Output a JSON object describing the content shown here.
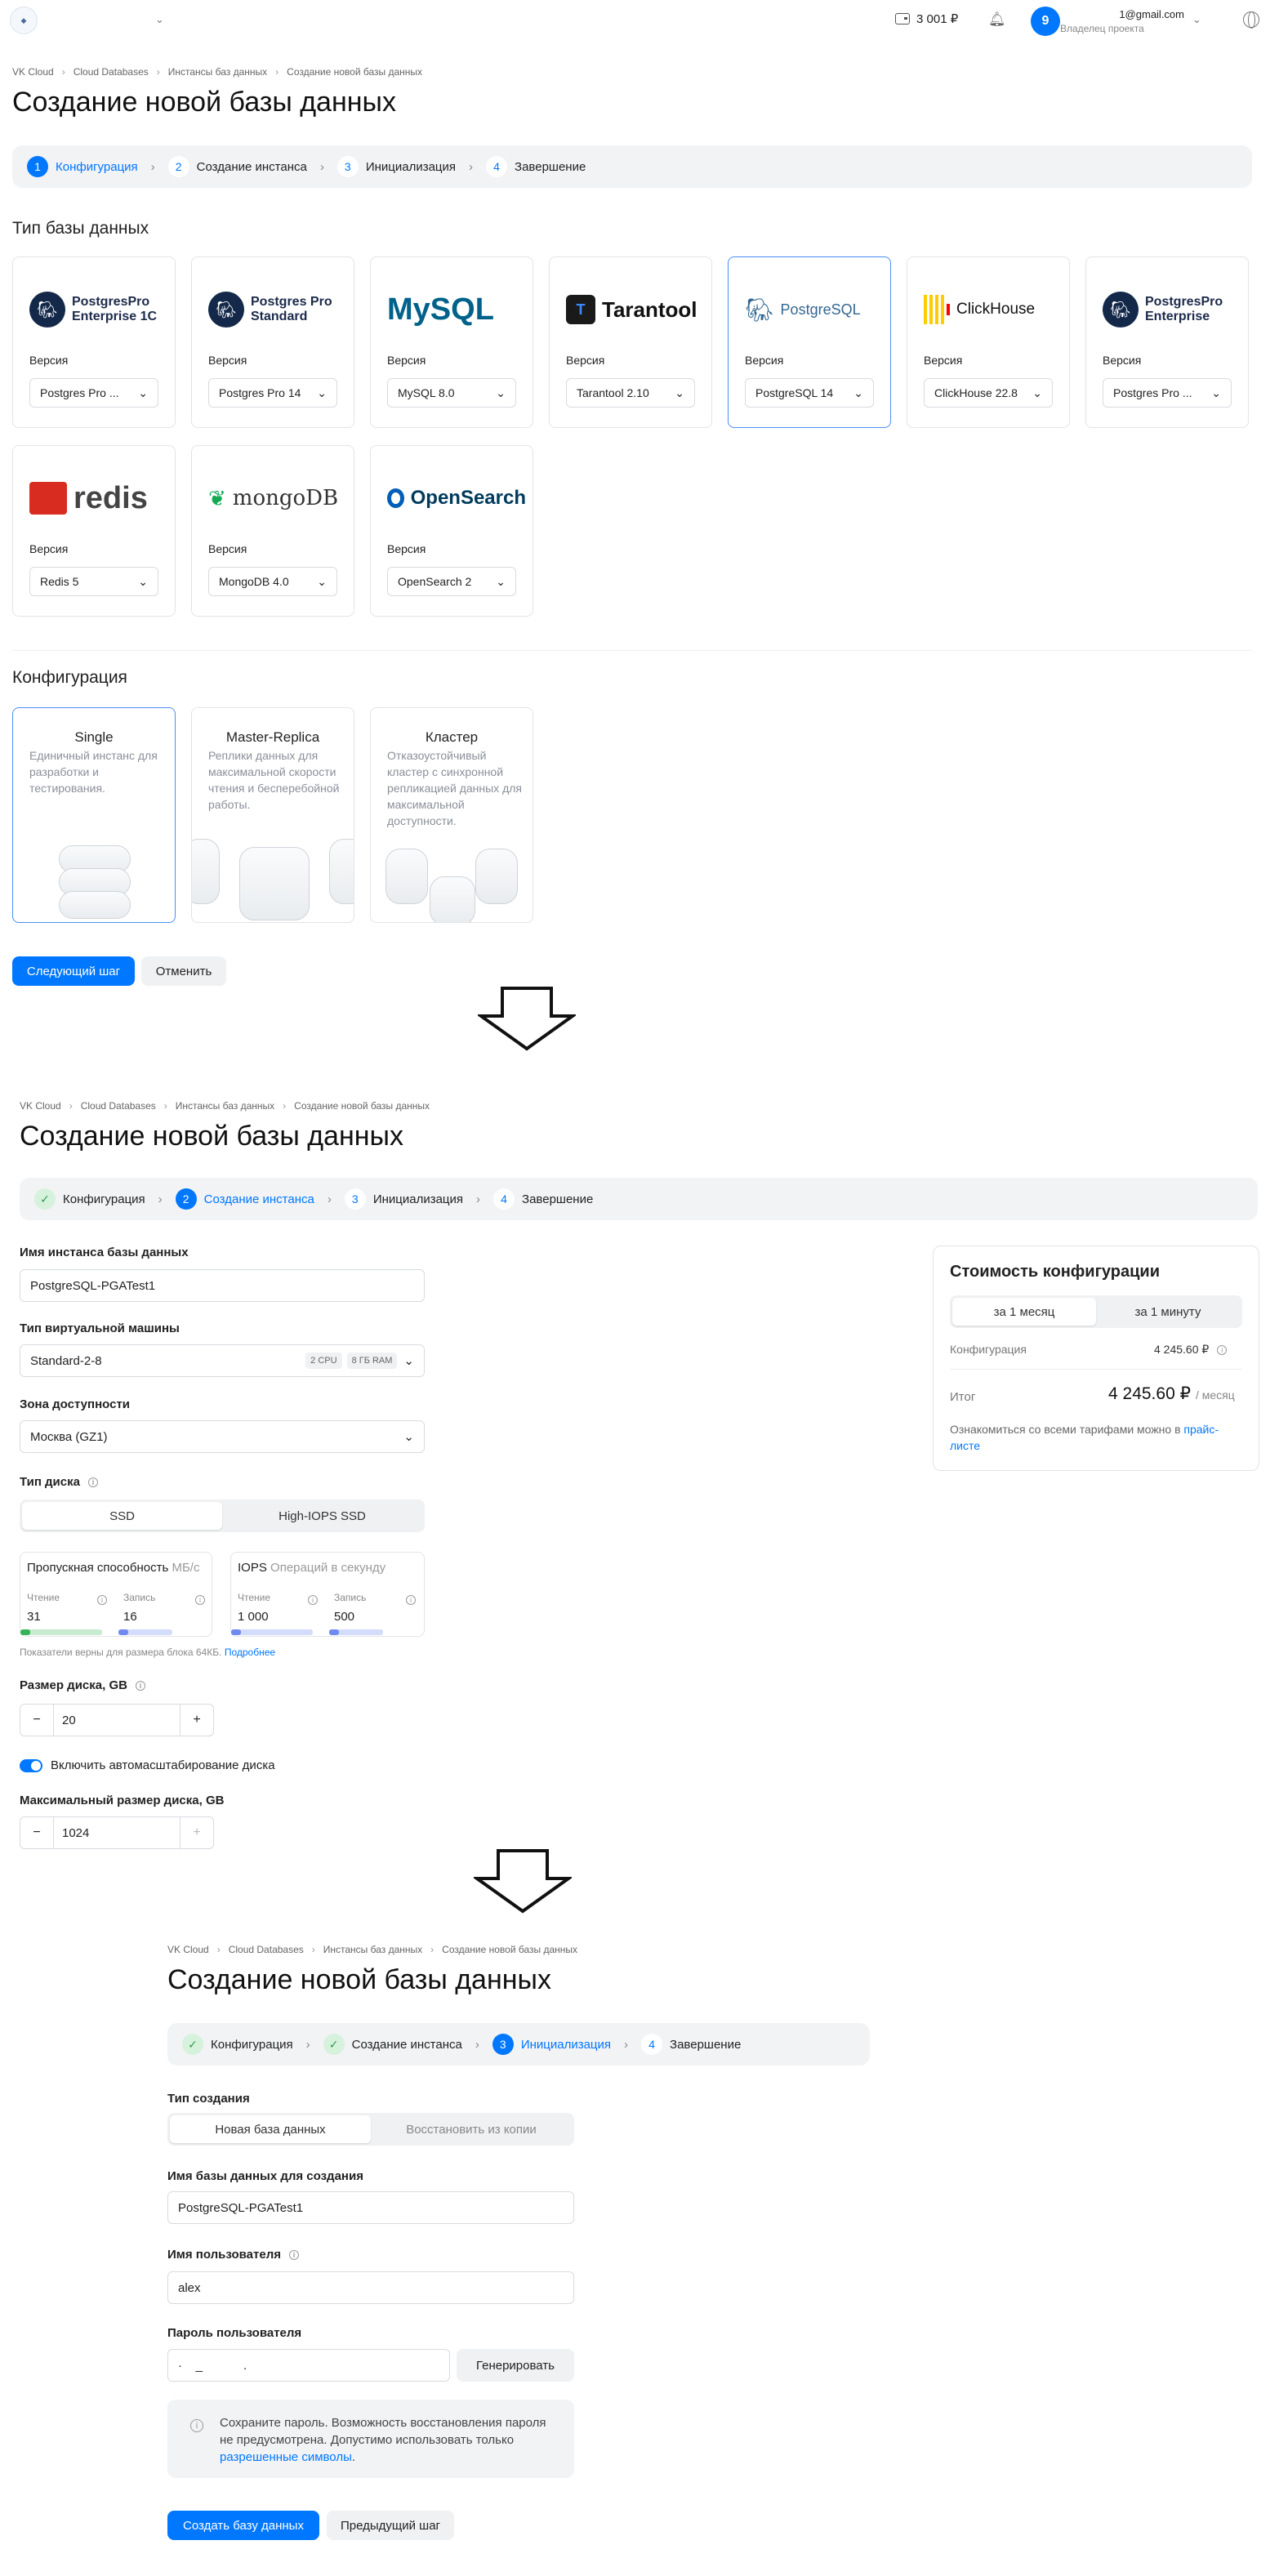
{
  "header": {
    "balance": "3 001 ₽",
    "avatar_letter": "9",
    "user_email": "1@gmail.com",
    "user_role": "Владелец проекта"
  },
  "breadcrumbs": [
    "VK Cloud",
    "Cloud Databases",
    "Инстансы баз данных",
    "Создание новой базы данных"
  ],
  "page_title": "Создание новой базы данных",
  "steps": [
    {
      "num": "1",
      "label": "Конфигурация"
    },
    {
      "num": "2",
      "label": "Создание инстанса"
    },
    {
      "num": "3",
      "label": "Инициализация"
    },
    {
      "num": "4",
      "label": "Завершение"
    }
  ],
  "step_done_icon": "✓",
  "screen1": {
    "db_type_title": "Тип базы данных",
    "version_label": "Версия",
    "db_types": [
      {
        "brand": "PostgresPro Enterprise 1C",
        "version": "Postgres Pro ..."
      },
      {
        "brand": "Postgres Pro Standard",
        "version": "Postgres Pro 14"
      },
      {
        "brand": "MySQL",
        "version": "MySQL 8.0"
      },
      {
        "brand": "Tarantool",
        "version": "Tarantool 2.10"
      },
      {
        "brand": "PostgreSQL",
        "version": "PostgreSQL 14",
        "selected": true
      },
      {
        "brand": "ClickHouse",
        "version": "ClickHouse 22.8"
      },
      {
        "brand": "PostgresPro Enterprise",
        "version": "Postgres Pro ..."
      },
      {
        "brand": "redis",
        "version": "Redis 5"
      },
      {
        "brand": "mongoDB",
        "version": "MongoDB 4.0"
      },
      {
        "brand": "OpenSearch",
        "version": "OpenSearch 2"
      }
    ],
    "config_title": "Конфигурация",
    "configs": [
      {
        "title": "Single",
        "desc": "Единичный инстанс для разработки и тестирования.",
        "selected": true
      },
      {
        "title": "Master-Replica",
        "desc": "Реплики данных для максимальной скорости чтения и бесперебойной работы."
      },
      {
        "title": "Кластер",
        "desc": "Отказоустойчивый кластер с синхронной репликацией данных для максимальной доступности."
      }
    ],
    "next_button": "Следующий шаг",
    "cancel_button": "Отменить"
  },
  "screen2": {
    "instance_name_label": "Имя инстанса базы данных",
    "instance_name_value": "PostgreSQL-PGATest1",
    "vm_type_label": "Тип виртуальной машины",
    "vm_type_value": "Standard-2-8",
    "vm_cpu_tag": "2 CPU",
    "vm_ram_tag": "8 ГБ RAM",
    "zone_label": "Зона доступности",
    "zone_value": "Москва (GZ1)",
    "disk_type_label": "Тип диска",
    "disk_types": [
      "SSD",
      "High-IOPS SSD"
    ],
    "throughput_title": "Пропускная способность",
    "throughput_unit": "МБ/с",
    "iops_title": "IOPS",
    "iops_unit": "Операций в секунду",
    "read_label": "Чтение",
    "write_label": "Запись",
    "throughput_read": "31",
    "throughput_write": "16",
    "iops_read": "1 000",
    "iops_write": "500",
    "metrics_note": "Показатели верны для размера блока 64КБ.",
    "metrics_link": "Подробнее",
    "disk_size_label": "Размер диска, GB",
    "disk_size_value": "20",
    "autoscale_label": "Включить автомасштабирование диска",
    "max_disk_label": "Максимальный размер диска, GB",
    "max_disk_value": "1024",
    "cost": {
      "title": "Стоимость конфигурации",
      "periods": [
        "за 1 месяц",
        "за 1 минуту"
      ],
      "config_label": "Конфигурация",
      "config_value": "4 245.60 ₽",
      "total_label": "Итог",
      "total_value": "4 245.60 ₽",
      "total_unit": "/ месяц",
      "note": "Ознакомиться со всеми тарифами можно в",
      "note_link": "прайс-листе"
    }
  },
  "screen3": {
    "create_type_label": "Тип создания",
    "create_types": [
      "Новая база данных",
      "Восстановить из копии"
    ],
    "db_name_label": "Имя базы данных для создания",
    "db_name_value": "PostgreSQL-PGATest1",
    "user_label": "Имя пользователя",
    "user_value": "alex",
    "password_label": "Пароль пользователя",
    "password_value": "·    _            .",
    "generate_button": "Генерировать",
    "note_text": "Сохраните пароль. Возможность восстановления пароля не предусмотрена. Допустимо использовать только",
    "note_link": "разрешенные символы",
    "create_button": "Создать базу данных",
    "prev_button": "Предыдущий шаг"
  }
}
